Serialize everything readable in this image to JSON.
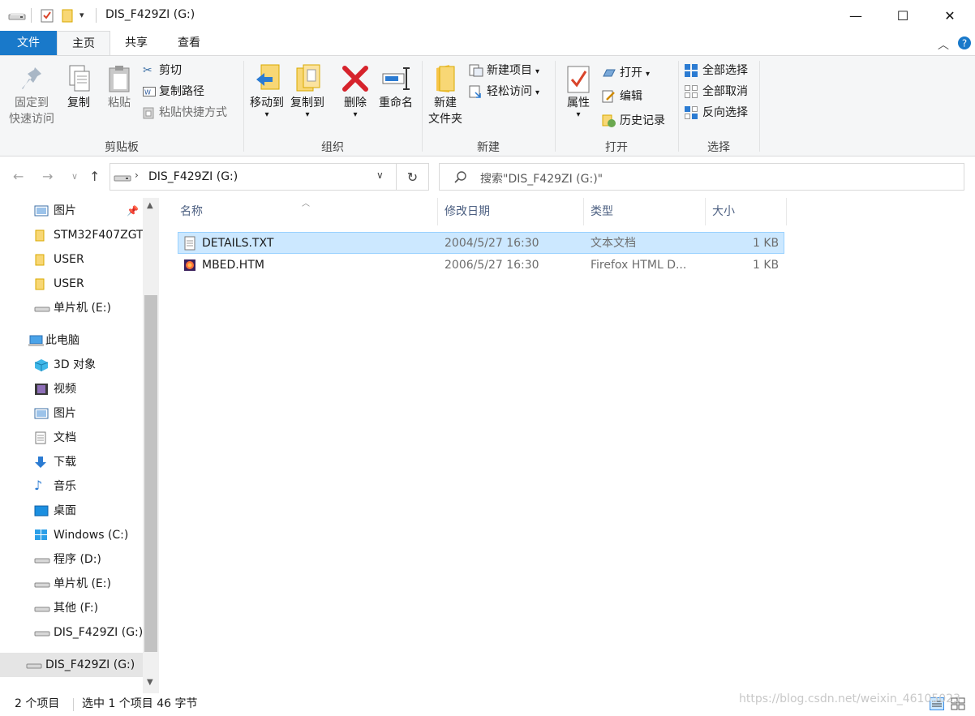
{
  "window": {
    "title": "DIS_F429ZI (G:)",
    "minimize": "—",
    "maximize": "☐",
    "close": "✕"
  },
  "tabs": [
    {
      "label": "文件"
    },
    {
      "label": "主页"
    },
    {
      "label": "共享"
    },
    {
      "label": "查看"
    }
  ],
  "ribbon": {
    "clipboard": {
      "label": "剪贴板",
      "pin_line1": "固定到",
      "pin_line2": "快速访问",
      "copy": "复制",
      "paste": "粘贴",
      "cut": "剪切",
      "copy_path": "复制路径",
      "paste_shortcut": "粘贴快捷方式"
    },
    "organize": {
      "label": "组织",
      "move_to": "移动到",
      "copy_to": "复制到",
      "delete": "删除",
      "rename": "重命名"
    },
    "new": {
      "label": "新建",
      "new_folder_line1": "新建",
      "new_folder_line2": "文件夹",
      "new_item": "新建项目",
      "easy_access": "轻松访问"
    },
    "open": {
      "label": "打开",
      "properties": "属性",
      "open": "打开",
      "edit": "编辑",
      "history": "历史记录"
    },
    "select": {
      "label": "选择",
      "select_all": "全部选择",
      "select_none": "全部取消",
      "invert": "反向选择"
    }
  },
  "address": {
    "path": "DIS_F429ZI (G:)",
    "search_placeholder": "搜索\"DIS_F429ZI (G:)\""
  },
  "nav": [
    {
      "label": "图片",
      "icon": "pictures-icon"
    },
    {
      "label": "STM32F407ZGT",
      "icon": "folder-icon"
    },
    {
      "label": "USER",
      "icon": "folder-icon"
    },
    {
      "label": "USER",
      "icon": "folder-icon"
    },
    {
      "label": "单片机 (E:)",
      "icon": "drive-icon"
    },
    {
      "label": "此电脑",
      "icon": "computer-icon"
    },
    {
      "label": "3D 对象",
      "icon": "3d-objects-icon"
    },
    {
      "label": "视频",
      "icon": "video-icon"
    },
    {
      "label": "图片",
      "icon": "pictures-icon"
    },
    {
      "label": "文档",
      "icon": "document-icon"
    },
    {
      "label": "下载",
      "icon": "download-icon"
    },
    {
      "label": "音乐",
      "icon": "music-icon"
    },
    {
      "label": "桌面",
      "icon": "desktop-icon"
    },
    {
      "label": "Windows  (C:)",
      "icon": "windows-drive-icon"
    },
    {
      "label": "程序 (D:)",
      "icon": "drive-icon"
    },
    {
      "label": "单片机 (E:)",
      "icon": "drive-icon"
    },
    {
      "label": "其他 (F:)",
      "icon": "drive-icon"
    },
    {
      "label": "DIS_F429ZI (G:)",
      "icon": "drive-icon"
    },
    {
      "label": "DIS_F429ZI (G:)",
      "icon": "drive-icon"
    }
  ],
  "columns": {
    "name": "名称",
    "modified": "修改日期",
    "type": "类型",
    "size": "大小"
  },
  "files": [
    {
      "name": "DETAILS.TXT",
      "modified": "2004/5/27 16:30",
      "type": "文本文档",
      "size": "1 KB"
    },
    {
      "name": "MBED.HTM",
      "modified": "2006/5/27 16:30",
      "type": "Firefox HTML D...",
      "size": "1 KB"
    }
  ],
  "status": {
    "count": "2 个项目",
    "selected": "选中 1 个项目  46 字节"
  },
  "watermark": "https://blog.csdn.net/weixin_46105023"
}
